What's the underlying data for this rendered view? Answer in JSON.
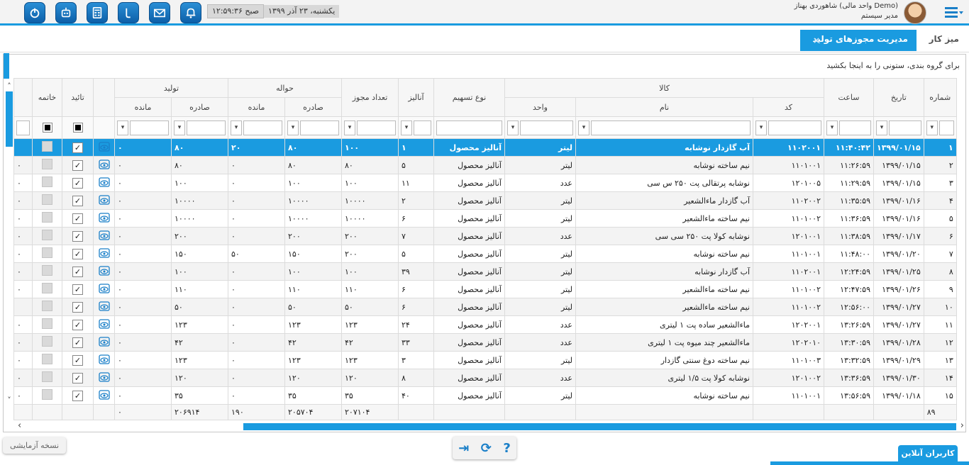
{
  "header": {
    "clock": "۱۲:۵۹:۳۶ صبح",
    "date": "یکشنبه، ۲۳ آذر ۱۳۹۹",
    "user_name": "شاهوردی بهناز (واحد مالی Demo)",
    "user_role": "مدیر سیستم",
    "icons": [
      "power-icon",
      "robot-icon",
      "calculator-icon",
      "phone-icon",
      "mail-icon",
      "bell-icon"
    ]
  },
  "tabs": {
    "desk": "میز کار",
    "active": "مدیریت مجوزهای تولید",
    "close": "×"
  },
  "grid": {
    "group_hint": "برای گروه بندی، ستونی را به اینجا بکشید",
    "headers": {
      "number": "شماره",
      "date": "تاریخ",
      "time": "ساعت",
      "goods": "کالا",
      "code": "کد",
      "name": "نام",
      "unit": "واحد",
      "share_type": "نوع تسهیم",
      "analysis": "آنالیز",
      "permit_count": "تعداد مجوز",
      "transfer": "حواله",
      "issued": "صادره",
      "remaining": "مانده",
      "production": "تولید",
      "approve": "تائید",
      "close": "خاتمه"
    },
    "rows": [
      {
        "num": "۱",
        "date": "۱۳۹۹/۰۱/۱۵",
        "time": "۱۱:۴۰:۴۲",
        "code": "۱۱۰۲۰۰۱",
        "name": "آب گازدار نوشابه",
        "unit": "لیتر",
        "type": "آنالیز محصول",
        "analysis": "۱",
        "count": "۱۰۰",
        "tr_issued": "۸۰",
        "tr_remain": "۲۰",
        "pr_issued": "۸۰",
        "pr_remain": "۰",
        "end": ""
      },
      {
        "num": "۲",
        "date": "۱۳۹۹/۰۱/۱۵",
        "time": "۱۱:۲۶:۵۹",
        "code": "۱۱۰۱۰۰۱",
        "name": "نیم ساخته نوشابه",
        "unit": "لیتر",
        "type": "آنالیز محصول",
        "analysis": "۵",
        "count": "۸۰",
        "tr_issued": "۸۰",
        "tr_remain": "۰",
        "pr_issued": "۸۰",
        "pr_remain": "۰",
        "end": "۰"
      },
      {
        "num": "۳",
        "date": "۱۳۹۹/۰۱/۱۵",
        "time": "۱۱:۲۹:۵۹",
        "code": "۱۲۰۱۰۰۵",
        "name": "نوشابه پرتقالی پت ۲۵۰ س سی",
        "unit": "عدد",
        "type": "آنالیز محصول",
        "analysis": "۱۱",
        "count": "۱۰۰",
        "tr_issued": "۱۰۰",
        "tr_remain": "۰",
        "pr_issued": "۱۰۰",
        "pr_remain": "۰",
        "end": "۰"
      },
      {
        "num": "۴",
        "date": "۱۳۹۹/۰۱/۱۶",
        "time": "۱۱:۳۵:۵۹",
        "code": "۱۱۰۲۰۰۲",
        "name": "آب گازدار ماءالشعیر",
        "unit": "لیتر",
        "type": "آنالیز محصول",
        "analysis": "۲",
        "count": "۱۰۰۰۰",
        "tr_issued": "۱۰۰۰۰",
        "tr_remain": "۰",
        "pr_issued": "۱۰۰۰۰",
        "pr_remain": "۰",
        "end": "۰"
      },
      {
        "num": "۵",
        "date": "۱۳۹۹/۰۱/۱۶",
        "time": "۱۱:۳۶:۵۹",
        "code": "۱۱۰۱۰۰۲",
        "name": "نیم ساخته ماءالشعیر",
        "unit": "لیتر",
        "type": "آنالیز محصول",
        "analysis": "۶",
        "count": "۱۰۰۰۰",
        "tr_issued": "۱۰۰۰۰",
        "tr_remain": "۰",
        "pr_issued": "۱۰۰۰۰",
        "pr_remain": "۰",
        "end": "۰"
      },
      {
        "num": "۶",
        "date": "۱۳۹۹/۰۱/۱۷",
        "time": "۱۱:۳۸:۵۹",
        "code": "۱۲۰۱۰۰۱",
        "name": "نوشابه کولا پت ۲۵۰ سی سی",
        "unit": "عدد",
        "type": "آنالیز محصول",
        "analysis": "۷",
        "count": "۲۰۰",
        "tr_issued": "۲۰۰",
        "tr_remain": "۰",
        "pr_issued": "۲۰۰",
        "pr_remain": "۰",
        "end": "۰"
      },
      {
        "num": "۷",
        "date": "۱۳۹۹/۰۱/۲۰",
        "time": "۱۱:۴۸:۰۰",
        "code": "۱۱۰۱۰۰۱",
        "name": "نیم ساخته نوشابه",
        "unit": "لیتر",
        "type": "آنالیز محصول",
        "analysis": "۵",
        "count": "۲۰۰",
        "tr_issued": "۱۵۰",
        "tr_remain": "۵۰",
        "pr_issued": "۱۵۰",
        "pr_remain": "۰",
        "end": "۰"
      },
      {
        "num": "۸",
        "date": "۱۳۹۹/۰۱/۲۵",
        "time": "۱۲:۲۴:۵۹",
        "code": "۱۱۰۲۰۰۱",
        "name": "آب گازدار نوشابه",
        "unit": "لیتر",
        "type": "آنالیز محصول",
        "analysis": "۳۹",
        "count": "۱۰۰",
        "tr_issued": "۱۰۰",
        "tr_remain": "۰",
        "pr_issued": "۱۰۰",
        "pr_remain": "۰",
        "end": "۰"
      },
      {
        "num": "۹",
        "date": "۱۳۹۹/۰۱/۲۶",
        "time": "۱۲:۴۷:۵۹",
        "code": "۱۱۰۱۰۰۲",
        "name": "نیم ساخته ماءالشعیر",
        "unit": "لیتر",
        "type": "آنالیز محصول",
        "analysis": "۶",
        "count": "۱۱۰",
        "tr_issued": "۱۱۰",
        "tr_remain": "۰",
        "pr_issued": "۱۱۰",
        "pr_remain": "۰",
        "end": "۰"
      },
      {
        "num": "۱۰",
        "date": "۱۳۹۹/۰۱/۲۷",
        "time": "۱۲:۵۶:۰۰",
        "code": "۱۱۰۱۰۰۲",
        "name": "نیم ساخته ماءالشعیر",
        "unit": "لیتر",
        "type": "آنالیز محصول",
        "analysis": "۶",
        "count": "۵۰",
        "tr_issued": "۵۰",
        "tr_remain": "۰",
        "pr_issued": "۵۰",
        "pr_remain": "۰",
        "end": ""
      },
      {
        "num": "۱۱",
        "date": "۱۳۹۹/۰۱/۲۷",
        "time": "۱۳:۲۶:۵۹",
        "code": "۱۲۰۲۰۰۱",
        "name": "ماءالشعیر ساده پت ۱ لیتری",
        "unit": "عدد",
        "type": "آنالیز محصول",
        "analysis": "۲۴",
        "count": "۱۲۳",
        "tr_issued": "۱۲۳",
        "tr_remain": "۰",
        "pr_issued": "۱۲۳",
        "pr_remain": "۰",
        "end": "۰"
      },
      {
        "num": "۱۲",
        "date": "۱۳۹۹/۰۱/۲۸",
        "time": "۱۳:۳۰:۵۹",
        "code": "۱۲۰۲۰۱۰",
        "name": "ماءالشعیر چند میوه پت ۱ لیتری",
        "unit": "عدد",
        "type": "آنالیز محصول",
        "analysis": "۳۳",
        "count": "۴۲",
        "tr_issued": "۴۲",
        "tr_remain": "۰",
        "pr_issued": "۴۲",
        "pr_remain": "۰",
        "end": "۰"
      },
      {
        "num": "۱۳",
        "date": "۱۳۹۹/۰۱/۲۹",
        "time": "۱۳:۳۲:۵۹",
        "code": "۱۱۰۱۰۰۳",
        "name": "نیم ساخته دوغ سنتی گازدار",
        "unit": "لیتر",
        "type": "آنالیز محصول",
        "analysis": "۳",
        "count": "۱۲۳",
        "tr_issued": "۱۲۳",
        "tr_remain": "۰",
        "pr_issued": "۱۲۳",
        "pr_remain": "۰",
        "end": "۰"
      },
      {
        "num": "۱۴",
        "date": "۱۳۹۹/۰۱/۳۰",
        "time": "۱۳:۳۶:۵۹",
        "code": "۱۲۰۱۰۰۲",
        "name": "نوشابه کولا پت ۱/۵ لیتری",
        "unit": "عدد",
        "type": "آنالیز محصول",
        "analysis": "۸",
        "count": "۱۲۰",
        "tr_issued": "۱۲۰",
        "tr_remain": "۰",
        "pr_issued": "۱۲۰",
        "pr_remain": "۰",
        "end": "۰"
      },
      {
        "num": "۱۵",
        "date": "۱۳۹۹/۰۱/۱۸",
        "time": "۱۳:۵۶:۵۹",
        "code": "۱۱۰۱۰۰۱",
        "name": "نیم ساخته نوشابه",
        "unit": "لیتر",
        "type": "آنالیز محصول",
        "analysis": "۴۰",
        "count": "۳۵",
        "tr_issued": "۳۵",
        "tr_remain": "۰",
        "pr_issued": "۳۵",
        "pr_remain": "۰",
        "end": "۰"
      }
    ],
    "footer": {
      "row_count": "۸۹",
      "count_total": "۲۰۷۱۰۴",
      "tr_issued_total": "۲۰۵۷۰۴",
      "tr_remain_total": "۱۹۰",
      "pr_issued_total": "۲۰۶۹۱۴",
      "pr_remain_total": "۰"
    },
    "checkmark": "✓",
    "scroll_left": "‹",
    "scroll_right": "›",
    "scroll_up": "˄",
    "scroll_down": "˅"
  },
  "bottom": {
    "trial_label": "نسخه آزمایشی",
    "help": "?",
    "refresh": "⟳",
    "exit": "⇥",
    "online_users": "کاربران آنلاین"
  },
  "colors": {
    "accent": "#1a9be0",
    "header_bg": "#f3f3f3"
  }
}
